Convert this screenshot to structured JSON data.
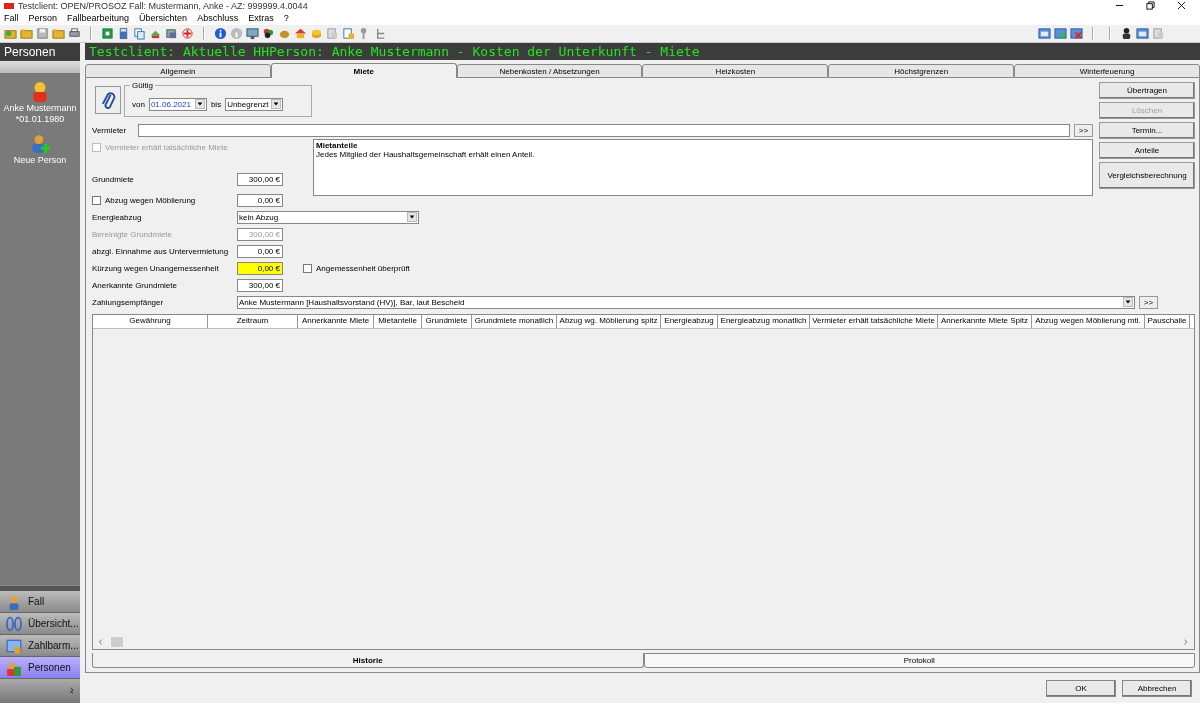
{
  "window": {
    "title": "Testclient: OPEN/PROSOZ Fall: Mustermann, Anke - AZ: 999999.4.0044"
  },
  "menu": [
    "Fall",
    "Person",
    "Fallbearbeitung",
    "Übersichten",
    "Abschluss",
    "Extras",
    "?"
  ],
  "sidebar": {
    "title": "Personen",
    "persons": [
      {
        "kind": "person",
        "name": "Anke Mustermann",
        "detail": "*01.01.1980"
      },
      {
        "kind": "add",
        "name": "Neue Person"
      }
    ],
    "nav": [
      {
        "kind": "case",
        "label": "Fall",
        "selected": false
      },
      {
        "kind": "overview",
        "label": "Übersicht...",
        "selected": false
      },
      {
        "kind": "payment",
        "label": "Zahlbarm...",
        "selected": false
      },
      {
        "kind": "persons",
        "label": "Personen",
        "selected": true
      }
    ]
  },
  "header": "Testclient: Aktuelle HHPerson: Anke Mustermann - Kosten der Unterkunft - Miete",
  "tabs": [
    {
      "label": "Allgemein",
      "selected": false
    },
    {
      "label": "Miete",
      "selected": true
    },
    {
      "label": "Nebenkosten / Absetzungen",
      "selected": false
    },
    {
      "label": "Heizkosten",
      "selected": false
    },
    {
      "label": "Höchstgrenzen",
      "selected": false
    },
    {
      "label": "Winterfeuerung",
      "selected": false
    }
  ],
  "validity": {
    "legend": "Gültig",
    "from_label": "von",
    "from": "01.06.2021",
    "to_label": "bis",
    "to": "Unbegrenzt"
  },
  "landlord": {
    "label": "Vermieter",
    "more": ">>"
  },
  "landlord_checkbox": {
    "label": "Vermieter erhält tatsächliche Miete",
    "checked": false,
    "disabled": true
  },
  "shares": {
    "title": "Mietanteile",
    "text": "Jedes Mitglied der Haushaltsgemeinschaft erhält einen Anteil."
  },
  "top_fields": [
    {
      "kind": "amount",
      "label": "Grundmiete",
      "value": "300,00 €",
      "disabled": false,
      "highlighted": false
    },
    {
      "kind": "check",
      "label": "Abzug wegen Möblierung",
      "checked": false,
      "value": "0,00 €"
    }
  ],
  "fields": [
    {
      "kind": "select",
      "label": "Energieabzug",
      "value": "kein Abzug"
    },
    {
      "kind": "amount",
      "label": "Bereinigte Grundmiete",
      "value": "300,00 €",
      "disabled": true,
      "highlighted": false
    },
    {
      "kind": "amount",
      "label": "abzgl. Einnahme aus Untervermietung",
      "value": "0,00 €",
      "disabled": false,
      "highlighted": false
    },
    {
      "kind": "amount",
      "label": "Kürzung wegen Unangemessenheit",
      "value": "0,00 €",
      "disabled": false,
      "highlighted": true,
      "extra": {
        "label": "Angemessenheit überprüft",
        "checked": false
      }
    },
    {
      "kind": "amount",
      "label": "Anerkannte Grundmiete",
      "value": "300,00 €",
      "disabled": false,
      "highlighted": false
    },
    {
      "kind": "wide",
      "label": "Zahlungsempfänger",
      "value": "Anke Mustermann [Haushaltsvorstand (HV)], Bar, laut Bescheid",
      "more": ">>"
    }
  ],
  "actions": [
    {
      "label": "Übertragen",
      "disabled": false
    },
    {
      "label": "Löschen",
      "disabled": true
    },
    {
      "label": "Termin...",
      "disabled": false
    },
    {
      "label": "Anteile",
      "disabled": false
    },
    {
      "label": "Vergleichsberechnung",
      "disabled": false
    }
  ],
  "table": {
    "columns": [
      "Gewährung",
      "Zeitraum",
      "Annerkannte Miete",
      "Mietanteile",
      "Grundmiete",
      "Grundmiete monatlich",
      "Abzug wg. Möblierung spitz",
      "Energieabzug",
      "Energieabzug monatlich",
      "Vermieter erhält tatsächliche Miete",
      "Annerkannte Miete Spitz",
      "Abzug wegen Möblierung mtl.",
      "Pauschalie"
    ]
  },
  "bottom_tabs": [
    {
      "label": "Historie",
      "selected": true
    },
    {
      "label": "Protokoll",
      "selected": false
    }
  ],
  "footer": [
    "OK",
    "Abbrechen"
  ]
}
